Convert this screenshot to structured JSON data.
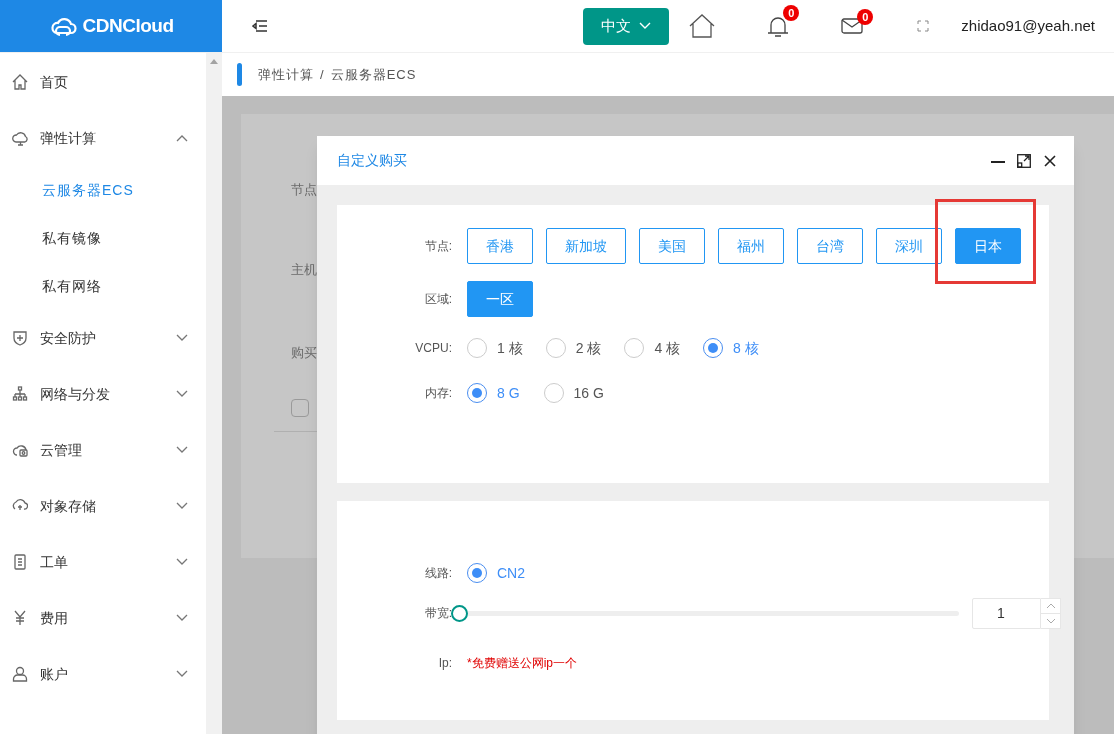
{
  "header": {
    "logo": "CDNCloud",
    "language": "中文",
    "notifications_badge": "0",
    "messages_badge": "0",
    "user": "zhidao91@yeah.net"
  },
  "sidebar": {
    "items": [
      {
        "kind": "link",
        "label": "首页"
      },
      {
        "kind": "group",
        "label": "弹性计算",
        "expanded": true,
        "children": [
          {
            "label": "云服务器ECS",
            "selected": true
          },
          {
            "label": "私有镜像",
            "selected": false
          },
          {
            "label": "私有网络",
            "selected": false
          }
        ]
      },
      {
        "kind": "group",
        "label": "安全防护",
        "expanded": false
      },
      {
        "kind": "group",
        "label": "网络与分发",
        "expanded": false
      },
      {
        "kind": "group",
        "label": "云管理",
        "expanded": false
      },
      {
        "kind": "group",
        "label": "对象存储",
        "expanded": false
      },
      {
        "kind": "group",
        "label": "工单",
        "expanded": false
      },
      {
        "kind": "group",
        "label": "费用",
        "expanded": false
      },
      {
        "kind": "group",
        "label": "账户",
        "expanded": false
      }
    ]
  },
  "breadcrumb": {
    "items": [
      "弹性计算",
      "云服务器ECS"
    ],
    "separator": "/"
  },
  "background_form": {
    "labels": [
      "节点",
      "主机",
      "购买"
    ],
    "checkbox_checked": false
  },
  "modal": {
    "title": "自定义购买",
    "sections": [
      {
        "rows": [
          {
            "kind": "buttons",
            "label": "节点:",
            "options": [
              {
                "label": "香港",
                "selected": false,
                "highlighted": false
              },
              {
                "label": "新加坡",
                "selected": false,
                "highlighted": false
              },
              {
                "label": "美国",
                "selected": false,
                "highlighted": false
              },
              {
                "label": "福州",
                "selected": false,
                "highlighted": false
              },
              {
                "label": "台湾",
                "selected": false,
                "highlighted": false
              },
              {
                "label": "深圳",
                "selected": false,
                "highlighted": false
              },
              {
                "label": "日本",
                "selected": true,
                "highlighted": true
              }
            ]
          },
          {
            "kind": "buttons",
            "label": "区域:",
            "options": [
              {
                "label": "一区",
                "selected": true
              }
            ]
          },
          {
            "kind": "radios",
            "label": "VCPU:",
            "options": [
              {
                "label": "1 核",
                "selected": false
              },
              {
                "label": "2 核",
                "selected": false
              },
              {
                "label": "4 核",
                "selected": false
              },
              {
                "label": "8 核",
                "selected": true
              }
            ]
          },
          {
            "kind": "radios",
            "label": "内存:",
            "options": [
              {
                "label": "8 G",
                "selected": true
              },
              {
                "label": "16 G",
                "selected": false
              }
            ]
          }
        ]
      },
      {
        "rows": [
          {
            "kind": "radios",
            "label": "线路:",
            "options": [
              {
                "label": "CN2",
                "selected": true
              }
            ]
          },
          {
            "kind": "slider",
            "label": "带宽:",
            "level": 0,
            "value": "1"
          },
          {
            "kind": "note",
            "label": "Ip:",
            "text": "*免费赠送公网ip一个"
          }
        ]
      }
    ]
  }
}
